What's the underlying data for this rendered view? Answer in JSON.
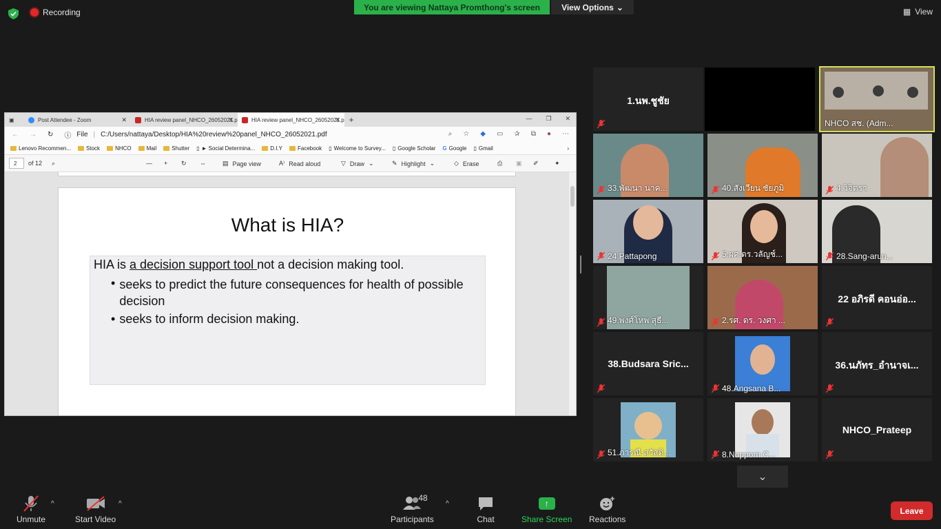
{
  "topbar": {
    "recording_label": "Recording",
    "viewing_banner": "You are viewing Nattaya Promthong's screen",
    "view_options_label": "View Options",
    "view_label": "View"
  },
  "browser": {
    "tabs": [
      {
        "label": "Post Attendee - Zoom"
      },
      {
        "label": "HIA review panel_NHCO_26052021.pdf"
      },
      {
        "label": "HIA review panel_NHCO_26052021.pdf"
      }
    ],
    "address_prefix": "File",
    "address_url": "C:/Users/nattaya/Desktop/HIA%20review%20panel_NHCO_26052021.pdf",
    "favorites": [
      "Lenovo Recommen...",
      "Stock",
      "NHCO",
      "Mail",
      "Shutter",
      "► Social Determina...",
      "D.I.Y",
      "Facebook",
      "Welcome to Survey...",
      "Google Scholar",
      "Google",
      "Gmail"
    ],
    "pdf_toolbar": {
      "page_number": "2",
      "page_total": "of 12",
      "page_view": "Page view",
      "read_aloud": "Read aloud",
      "draw": "Draw",
      "highlight": "Highlight",
      "erase": "Erase"
    },
    "slide": {
      "title": "What is HIA?",
      "lead_prefix": "HIA is ",
      "lead_underline": "a decision support tool ",
      "lead_suffix": "not a decision making tool.",
      "bullets": [
        "seeks to predict the future consequences for health of possible decision",
        " seeks to inform decision making."
      ]
    }
  },
  "gallery": [
    {
      "name": "1.นพ.ชูชัย",
      "type": "name"
    },
    {
      "name": "",
      "type": "blank"
    },
    {
      "name": "NHCO สช. (Adm...",
      "type": "video"
    },
    {
      "name": "33.พัฒนา นาค...",
      "type": "video"
    },
    {
      "name": "40.สังเวียน ชัยภูมิ",
      "type": "video"
    },
    {
      "name": "4.วิจิตรา",
      "type": "video"
    },
    {
      "name": "24.Pattapong",
      "type": "video"
    },
    {
      "name": "5.ผศ.ดร.วลัญช์...",
      "type": "video"
    },
    {
      "name": "28.Sang-arun...",
      "type": "video"
    },
    {
      "name": "49.พงศ์โหพ สุธี...",
      "type": "photo"
    },
    {
      "name": "2.รศ. ดร. วงศา ...",
      "type": "video"
    },
    {
      "name": "22 อภิรดี คอนอ่อ...",
      "type": "name"
    },
    {
      "name": "38.Budsara Sric...",
      "type": "name"
    },
    {
      "name": "48.Angsana B...",
      "type": "photo"
    },
    {
      "name": "36.นภัทร_อำนาจเ...",
      "type": "name"
    },
    {
      "name": "51.ภารณี สวัสดิ...",
      "type": "photo"
    },
    {
      "name": "8.Nopporn C...",
      "type": "photo"
    },
    {
      "name": "NHCO_Prateep",
      "type": "name"
    }
  ],
  "toolbar": {
    "unmute": "Unmute",
    "start_video": "Start Video",
    "participants": "Participants",
    "participants_count": "48",
    "chat": "Chat",
    "share_screen": "Share Screen",
    "reactions": "Reactions",
    "leave": "Leave"
  },
  "colors": {
    "share_green": "#2bb14a",
    "leave_red": "#d12b2b",
    "speaker_outline": "#d4e157"
  }
}
